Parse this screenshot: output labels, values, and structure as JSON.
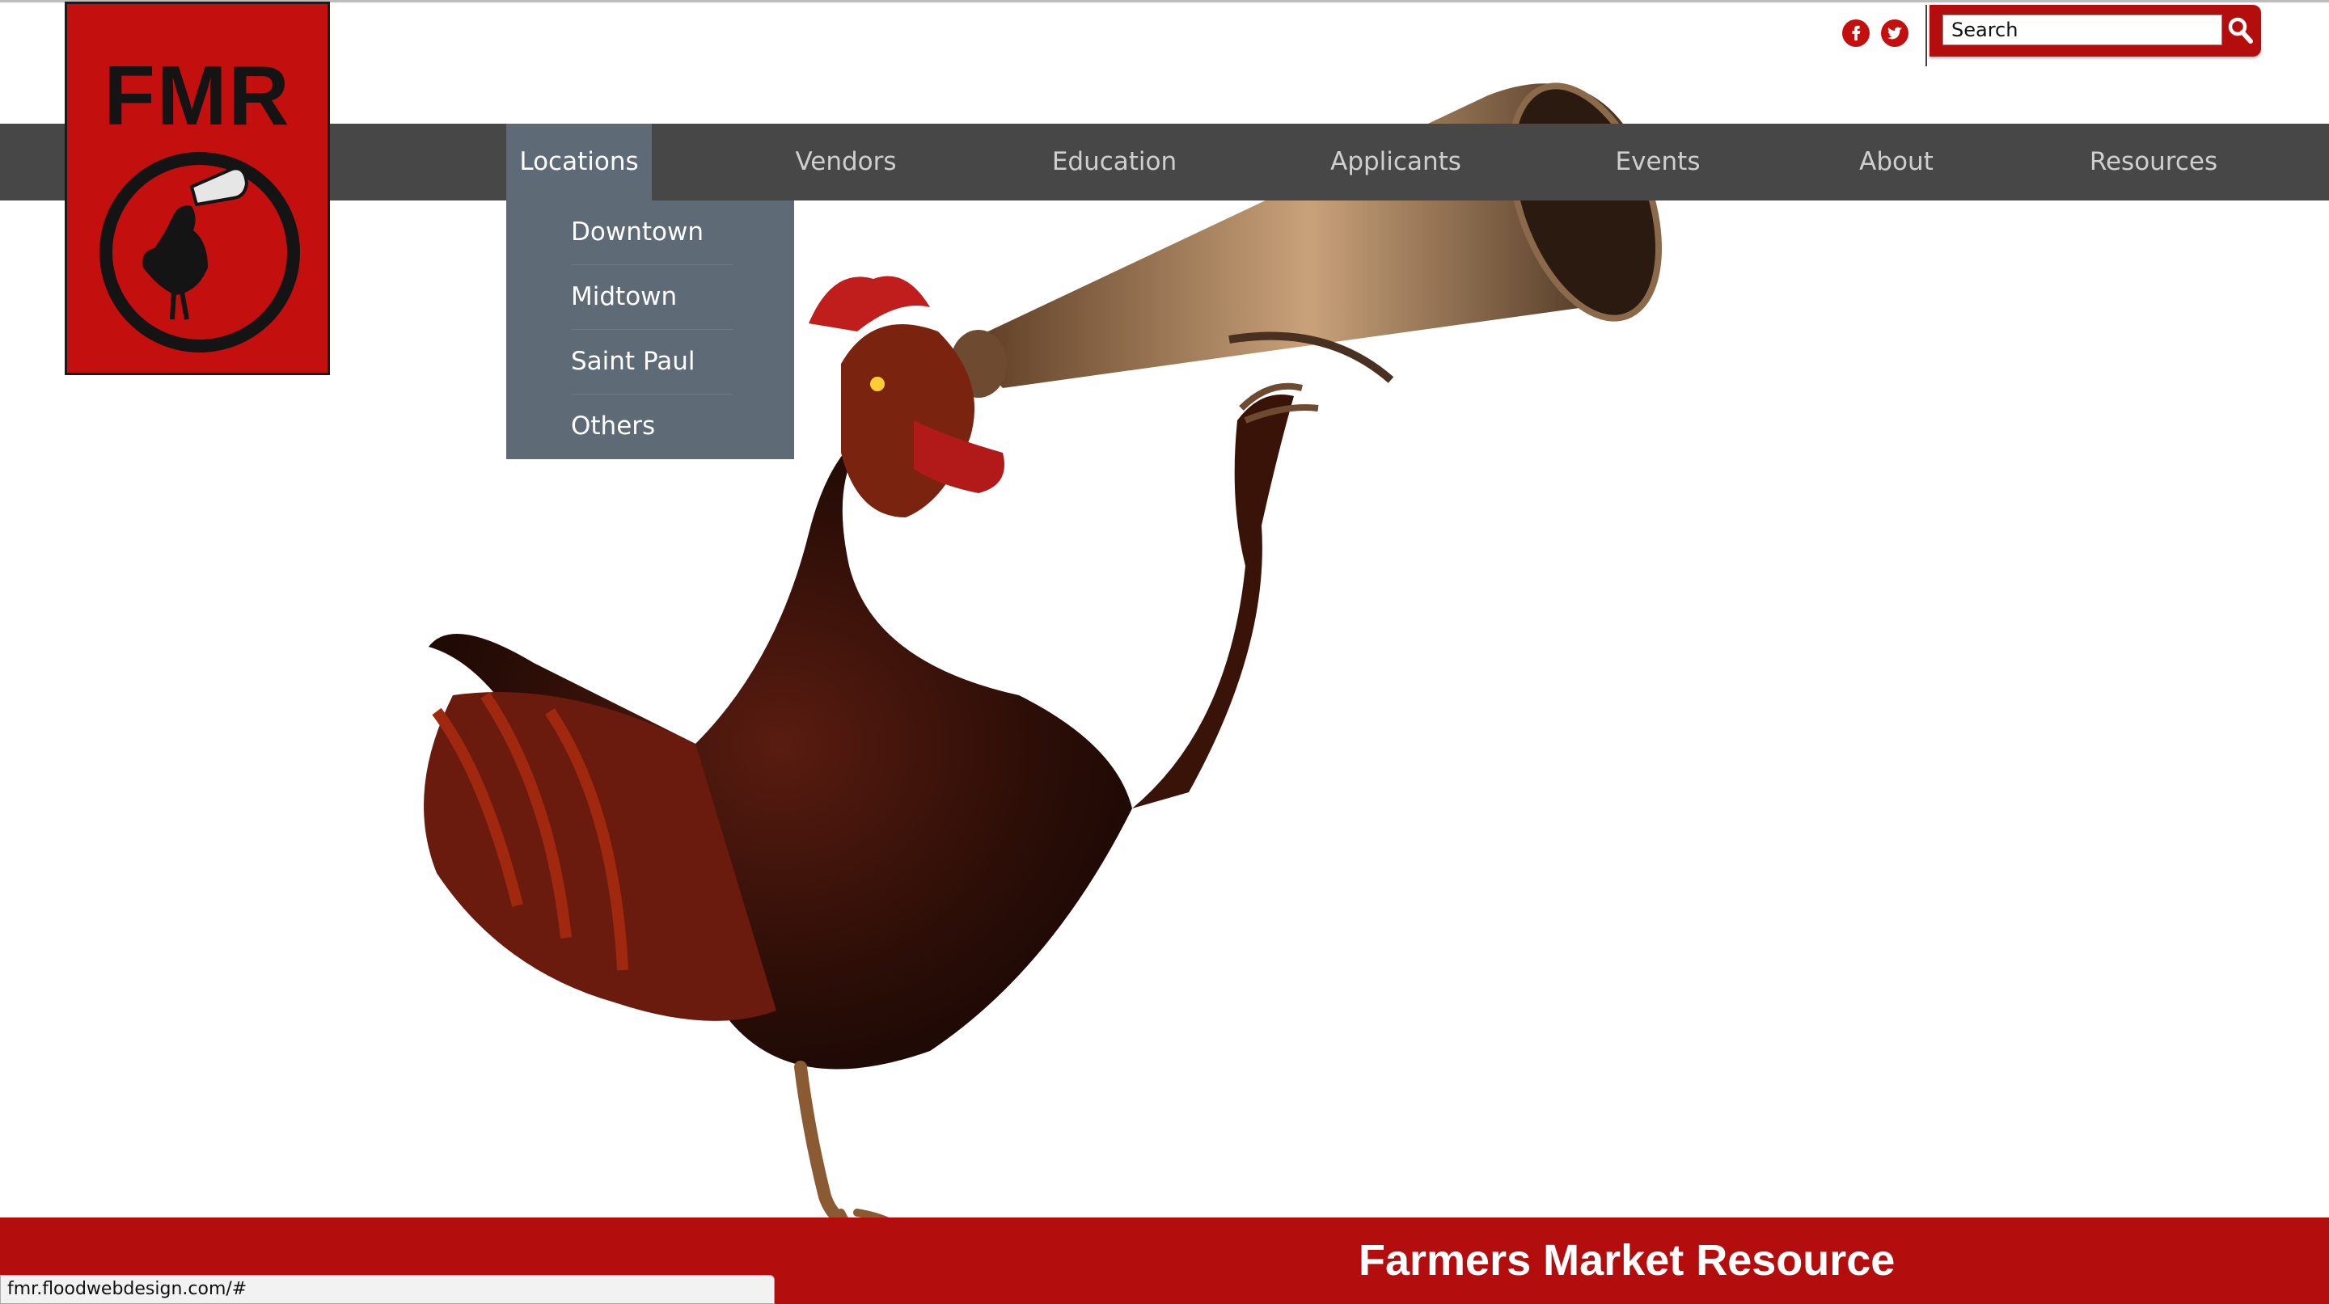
{
  "logo": {
    "text": "FMR"
  },
  "header": {
    "social": [
      {
        "name": "facebook",
        "glyph": "f"
      },
      {
        "name": "twitter",
        "glyph": "t"
      }
    ],
    "search": {
      "value": "Search",
      "button_icon": "search-icon"
    }
  },
  "nav": {
    "items": [
      {
        "label": "Locations",
        "active": true
      },
      {
        "label": "Vendors"
      },
      {
        "label": "Education"
      },
      {
        "label": "Applicants"
      },
      {
        "label": "Events"
      },
      {
        "label": "About"
      },
      {
        "label": "Resources"
      }
    ],
    "dropdown": [
      "Downtown",
      "Midtown",
      "Saint Paul",
      "Others"
    ]
  },
  "footer": {
    "title": "Farmers Market Resource"
  },
  "status_bar": {
    "url": "fmr.floodwebdesign.com/#"
  },
  "colors": {
    "brand_red": "#c40f0f",
    "nav_bg": "#474747",
    "nav_active": "#5e6a76"
  }
}
